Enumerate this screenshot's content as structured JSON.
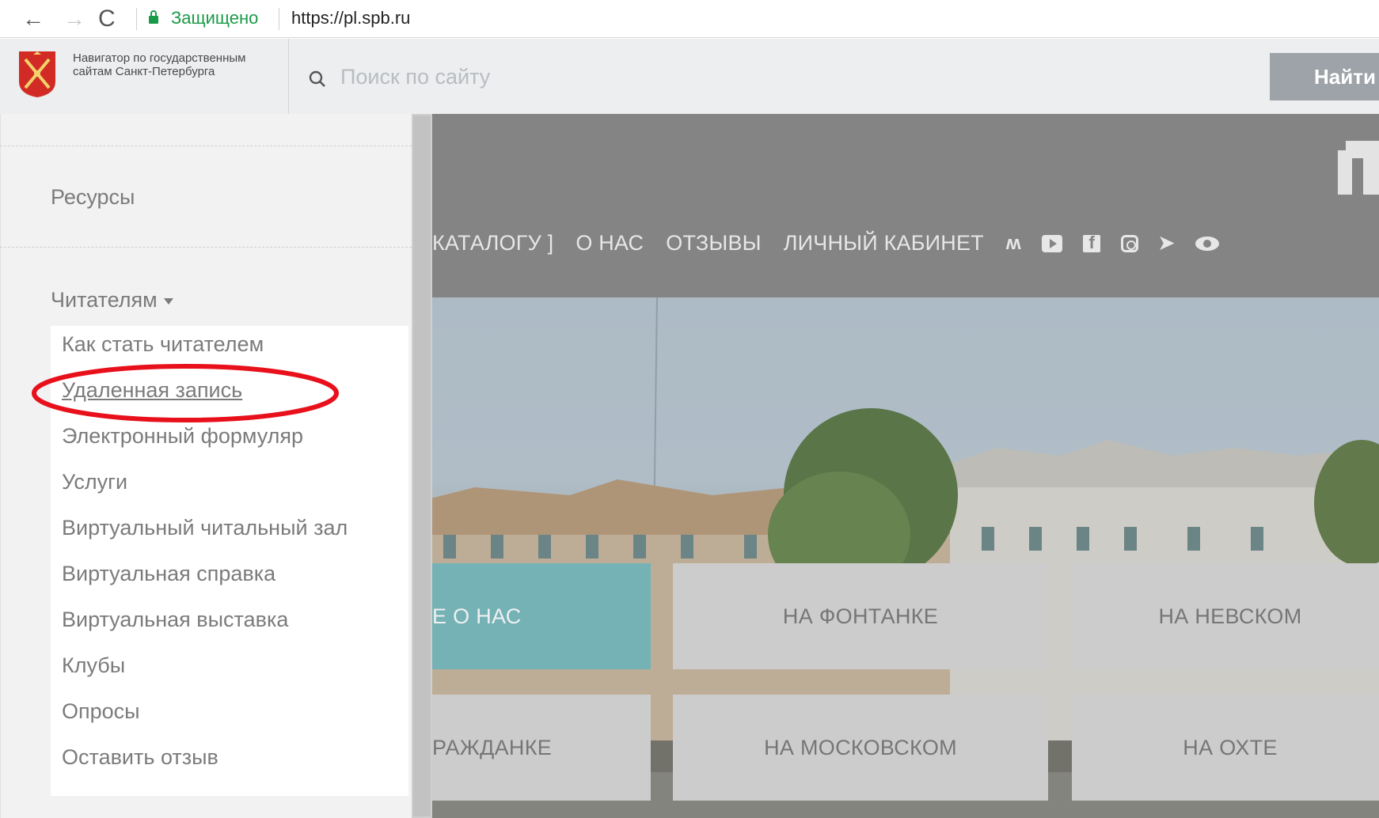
{
  "browser": {
    "back_icon": "←",
    "forward_icon": "→",
    "reload_icon": "C",
    "secure_label": "Защищено",
    "url": "https://pl.spb.ru"
  },
  "gov_header": {
    "title": "Навигатор по государственным сайтам Санкт-Петербурга",
    "search_placeholder": "Поиск по сайту",
    "search_value": "",
    "find_label": "Найти"
  },
  "site": {
    "nav": [
      "КАТАЛОГУ ]",
      "О НАС",
      "ОТЗЫВЫ",
      "ЛИЧНЫЙ КАБИНЕТ"
    ],
    "social_icons": [
      "vk-icon",
      "youtube-icon",
      "facebook-icon",
      "instagram-icon",
      "telegram-icon",
      "eye-icon"
    ],
    "tiles": [
      {
        "label": "Е О НАС"
      },
      {
        "label": "НА ФОНТАНКЕ"
      },
      {
        "label": "НА НЕВСКОМ"
      },
      {
        "label": "РАЖДАНКЕ"
      },
      {
        "label": "НА МОСКОВСКОМ"
      },
      {
        "label": "НА ОХТЕ"
      }
    ]
  },
  "sidebar": {
    "resources_label": "Ресурсы",
    "readers_label": "Читателям",
    "items": [
      {
        "label": "Как стать читателем"
      },
      {
        "label": "Удаленная запись"
      },
      {
        "label": "Электронный формуляр"
      },
      {
        "label": "Услуги"
      },
      {
        "label": "Виртуальный читальный зал"
      },
      {
        "label": "Виртуальная справка"
      },
      {
        "label": "Виртуальная выставка"
      },
      {
        "label": "Клубы"
      },
      {
        "label": "Опросы"
      },
      {
        "label": "Оставить отзыв"
      }
    ]
  },
  "colors": {
    "accent_teal": "#79bcc1",
    "highlight_red": "#e8101b",
    "secure_green": "#1a9a47"
  }
}
